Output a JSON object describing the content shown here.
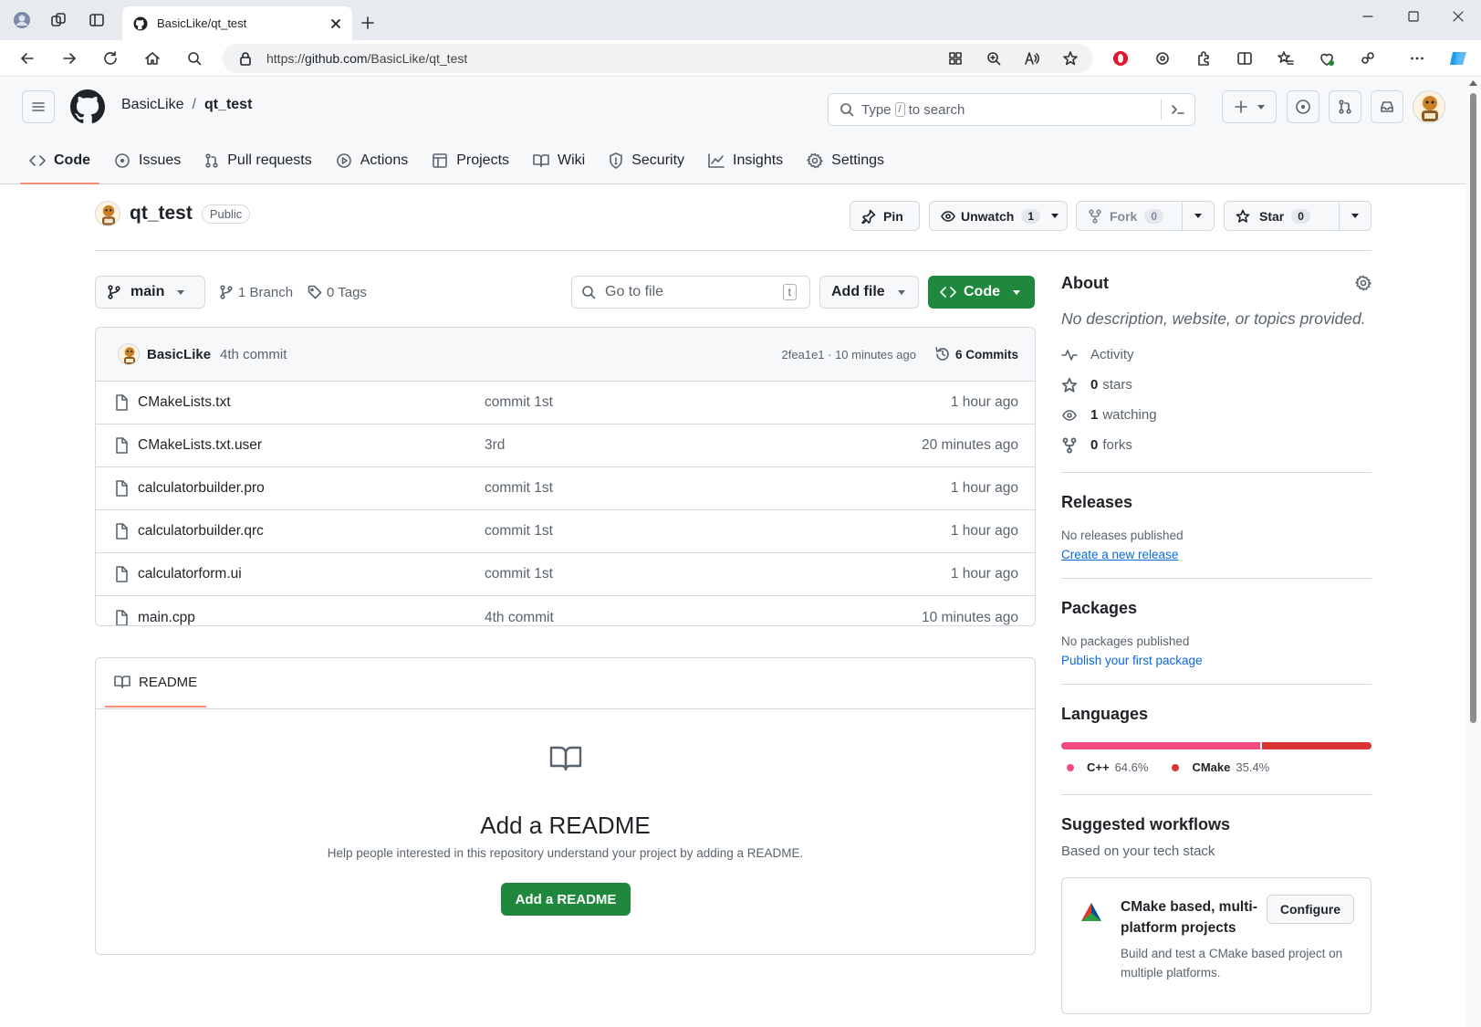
{
  "browser": {
    "tab_title": "BasicLike/qt_test",
    "url_prefix": "https://",
    "url_host": "github.com",
    "url_path": "/BasicLike/qt_test"
  },
  "header": {
    "owner": "BasicLike",
    "separator": "/",
    "repo": "qt_test",
    "search_prefix": "Type",
    "search_key": "/",
    "search_suffix": "to search"
  },
  "nav": [
    {
      "label": "Code",
      "icon": "code-icon"
    },
    {
      "label": "Issues",
      "icon": "issue-icon"
    },
    {
      "label": "Pull requests",
      "icon": "pull-request-icon"
    },
    {
      "label": "Actions",
      "icon": "play-icon"
    },
    {
      "label": "Projects",
      "icon": "table-icon"
    },
    {
      "label": "Wiki",
      "icon": "book-icon"
    },
    {
      "label": "Security",
      "icon": "shield-icon"
    },
    {
      "label": "Insights",
      "icon": "graph-icon"
    },
    {
      "label": "Settings",
      "icon": "gear-icon"
    }
  ],
  "repo": {
    "name": "qt_test",
    "visibility": "Public",
    "pin": "Pin",
    "unwatch": "Unwatch",
    "watch_count": "1",
    "fork": "Fork",
    "fork_count": "0",
    "star": "Star",
    "star_count": "0"
  },
  "controls": {
    "branch": "main",
    "branches": "1 Branch",
    "tags": "0 Tags",
    "go_to_file": "Go to file",
    "go_to_file_key": "t",
    "add_file": "Add file",
    "code": "Code"
  },
  "commit": {
    "author": "BasicLike",
    "message": "4th commit",
    "hash_time": "2fea1e1 · 10 minutes ago",
    "commits": "6 Commits"
  },
  "files": [
    {
      "name": "CMakeLists.txt",
      "message": "commit 1st",
      "age": "1 hour ago"
    },
    {
      "name": "CMakeLists.txt.user",
      "message": "3rd",
      "age": "20 minutes ago"
    },
    {
      "name": "calculatorbuilder.pro",
      "message": "commit 1st",
      "age": "1 hour ago"
    },
    {
      "name": "calculatorbuilder.qrc",
      "message": "commit 1st",
      "age": "1 hour ago"
    },
    {
      "name": "calculatorform.ui",
      "message": "commit 1st",
      "age": "1 hour ago"
    },
    {
      "name": "main.cpp",
      "message": "4th commit",
      "age": "10 minutes ago"
    }
  ],
  "readme": {
    "tab": "README",
    "title": "Add a README",
    "description": "Help people interested in this repository understand your project by adding a README.",
    "button": "Add a README"
  },
  "about": {
    "title": "About",
    "description": "No description, website, or topics provided.",
    "activity": "Activity",
    "stars_count": "0",
    "stars_label": "stars",
    "watching_count": "1",
    "watching_label": "watching",
    "forks_count": "0",
    "forks_label": "forks"
  },
  "releases": {
    "title": "Releases",
    "none": "No releases published",
    "link": "Create a new release"
  },
  "packages": {
    "title": "Packages",
    "none": "No packages published",
    "link": "Publish your first package"
  },
  "languages": {
    "title": "Languages",
    "items": [
      {
        "name": "C++",
        "percent": "64.6%",
        "value": 64.6,
        "color": "#f34b7d"
      },
      {
        "name": "CMake",
        "percent": "35.4%",
        "value": 35.4,
        "color": "#da3434"
      }
    ]
  },
  "workflows": {
    "title": "Suggested workflows",
    "subtitle": "Based on your tech stack",
    "card_title": "CMake based, multi-platform projects",
    "card_button": "Configure",
    "card_desc": "Build and test a CMake based project on multiple platforms."
  },
  "colors": {
    "accent_green": "#1f883d",
    "link_blue": "#0969da",
    "nav_underline": "#fd8c73"
  }
}
